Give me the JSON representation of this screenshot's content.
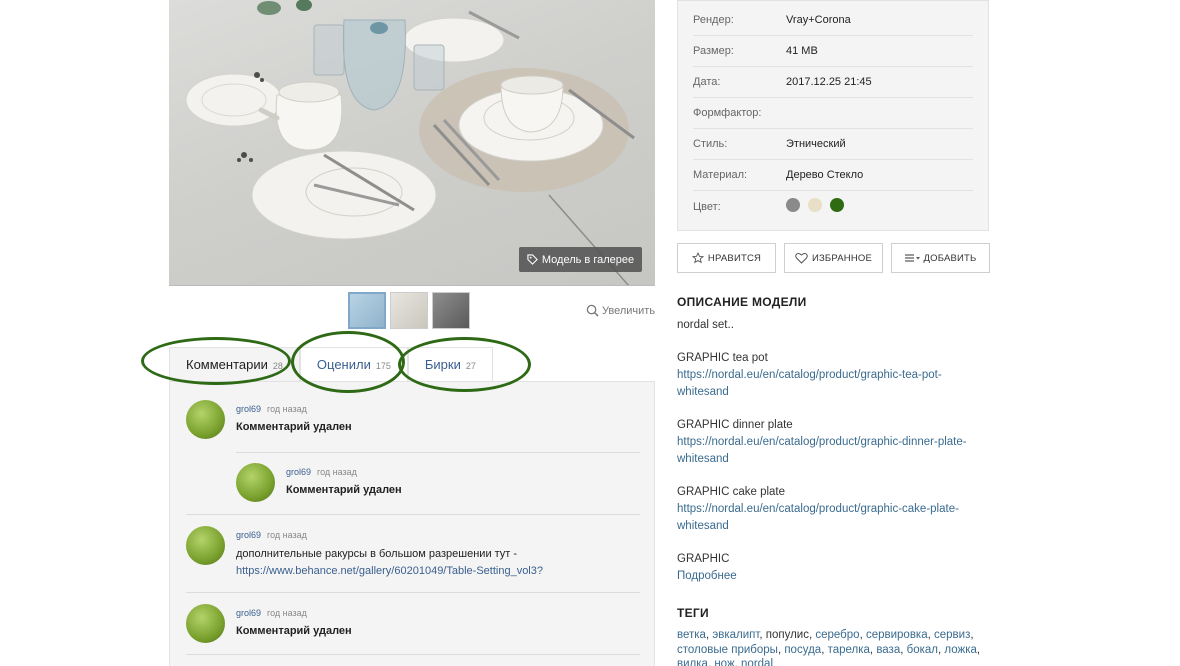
{
  "gallery": {
    "model_in_gallery_label": "Модель в галерее",
    "zoom_label": "Увеличить"
  },
  "tabs": [
    {
      "label": "Комментарии",
      "count": "28"
    },
    {
      "label": "Оценили",
      "count": "175"
    },
    {
      "label": "Бирки",
      "count": "27"
    }
  ],
  "comments": [
    {
      "user": "grol69",
      "time": "год назад",
      "text": "Комментарий удален"
    },
    {
      "user": "grol69",
      "time": "год назад",
      "text": "Комментарий удален"
    },
    {
      "user": "grol69",
      "time": "год назад",
      "text": "дополнительные ракурсы в большом разрешении тут -",
      "link": "https://www.behance.net/gallery/60201049/Table-Setting_vol3?"
    },
    {
      "user": "grol69",
      "time": "год назад",
      "text": "Комментарий удален"
    }
  ],
  "info": {
    "render": {
      "label": "Рендер:",
      "value": "Vray+Corona"
    },
    "size": {
      "label": "Размер:",
      "value": "41 MB"
    },
    "date": {
      "label": "Дата:",
      "value": "2017.12.25 21:45"
    },
    "formfactor": {
      "label": "Формфактор:",
      "value": ""
    },
    "style": {
      "label": "Стиль:",
      "value": "Этнический"
    },
    "material": {
      "label": "Материал:",
      "value": "Дерево Стекло"
    },
    "color": {
      "label": "Цвет:",
      "swatches": [
        "#8a8a8a",
        "#e8dfc6",
        "#2f6b12"
      ]
    }
  },
  "actions": {
    "like": "НРАВИТСЯ",
    "favorite": "ИЗБРАННОЕ",
    "add": "ДОБАВИТЬ"
  },
  "description": {
    "title": "ОПИСАНИЕ МОДЕЛИ",
    "intro": "nordal set..",
    "items": [
      {
        "name": "GRAPHIC tea pot",
        "url": "https://nordal.eu/en/catalog/product/graphic-tea-pot-whitesand"
      },
      {
        "name": "GRAPHIC dinner plate",
        "url": "https://nordal.eu/en/catalog/product/graphic-dinner-plate-whitesand"
      },
      {
        "name": "GRAPHIC cake plate",
        "url": "https://nordal.eu/en/catalog/product/graphic-cake-plate-whitesand"
      }
    ],
    "last": "GRAPHIC",
    "more": "Подробнее"
  },
  "tags": {
    "title": "ТЕГИ",
    "line1": [
      {
        "text": "ветка",
        "link": true
      },
      {
        "text": "эвкалипт",
        "link": true
      },
      {
        "text": "популис",
        "link": false
      },
      {
        "text": "серебро",
        "link": true
      },
      {
        "text": "сервировка",
        "link": true
      },
      {
        "text": "сервиз",
        "link": true
      }
    ],
    "line2": [
      {
        "text": "столовые приборы",
        "link": true
      },
      {
        "text": "посуда",
        "link": true
      },
      {
        "text": "тарелка",
        "link": true
      },
      {
        "text": "ваза",
        "link": true
      },
      {
        "text": "бокал",
        "link": true
      },
      {
        "text": "ложка",
        "link": true
      }
    ],
    "line3": [
      {
        "text": "вилка",
        "link": true
      },
      {
        "text": "нож",
        "link": true
      },
      {
        "text": "nordal",
        "link": true
      }
    ]
  },
  "colors": {
    "link": "#3a6b8f",
    "annotation": "#2e6a16"
  }
}
